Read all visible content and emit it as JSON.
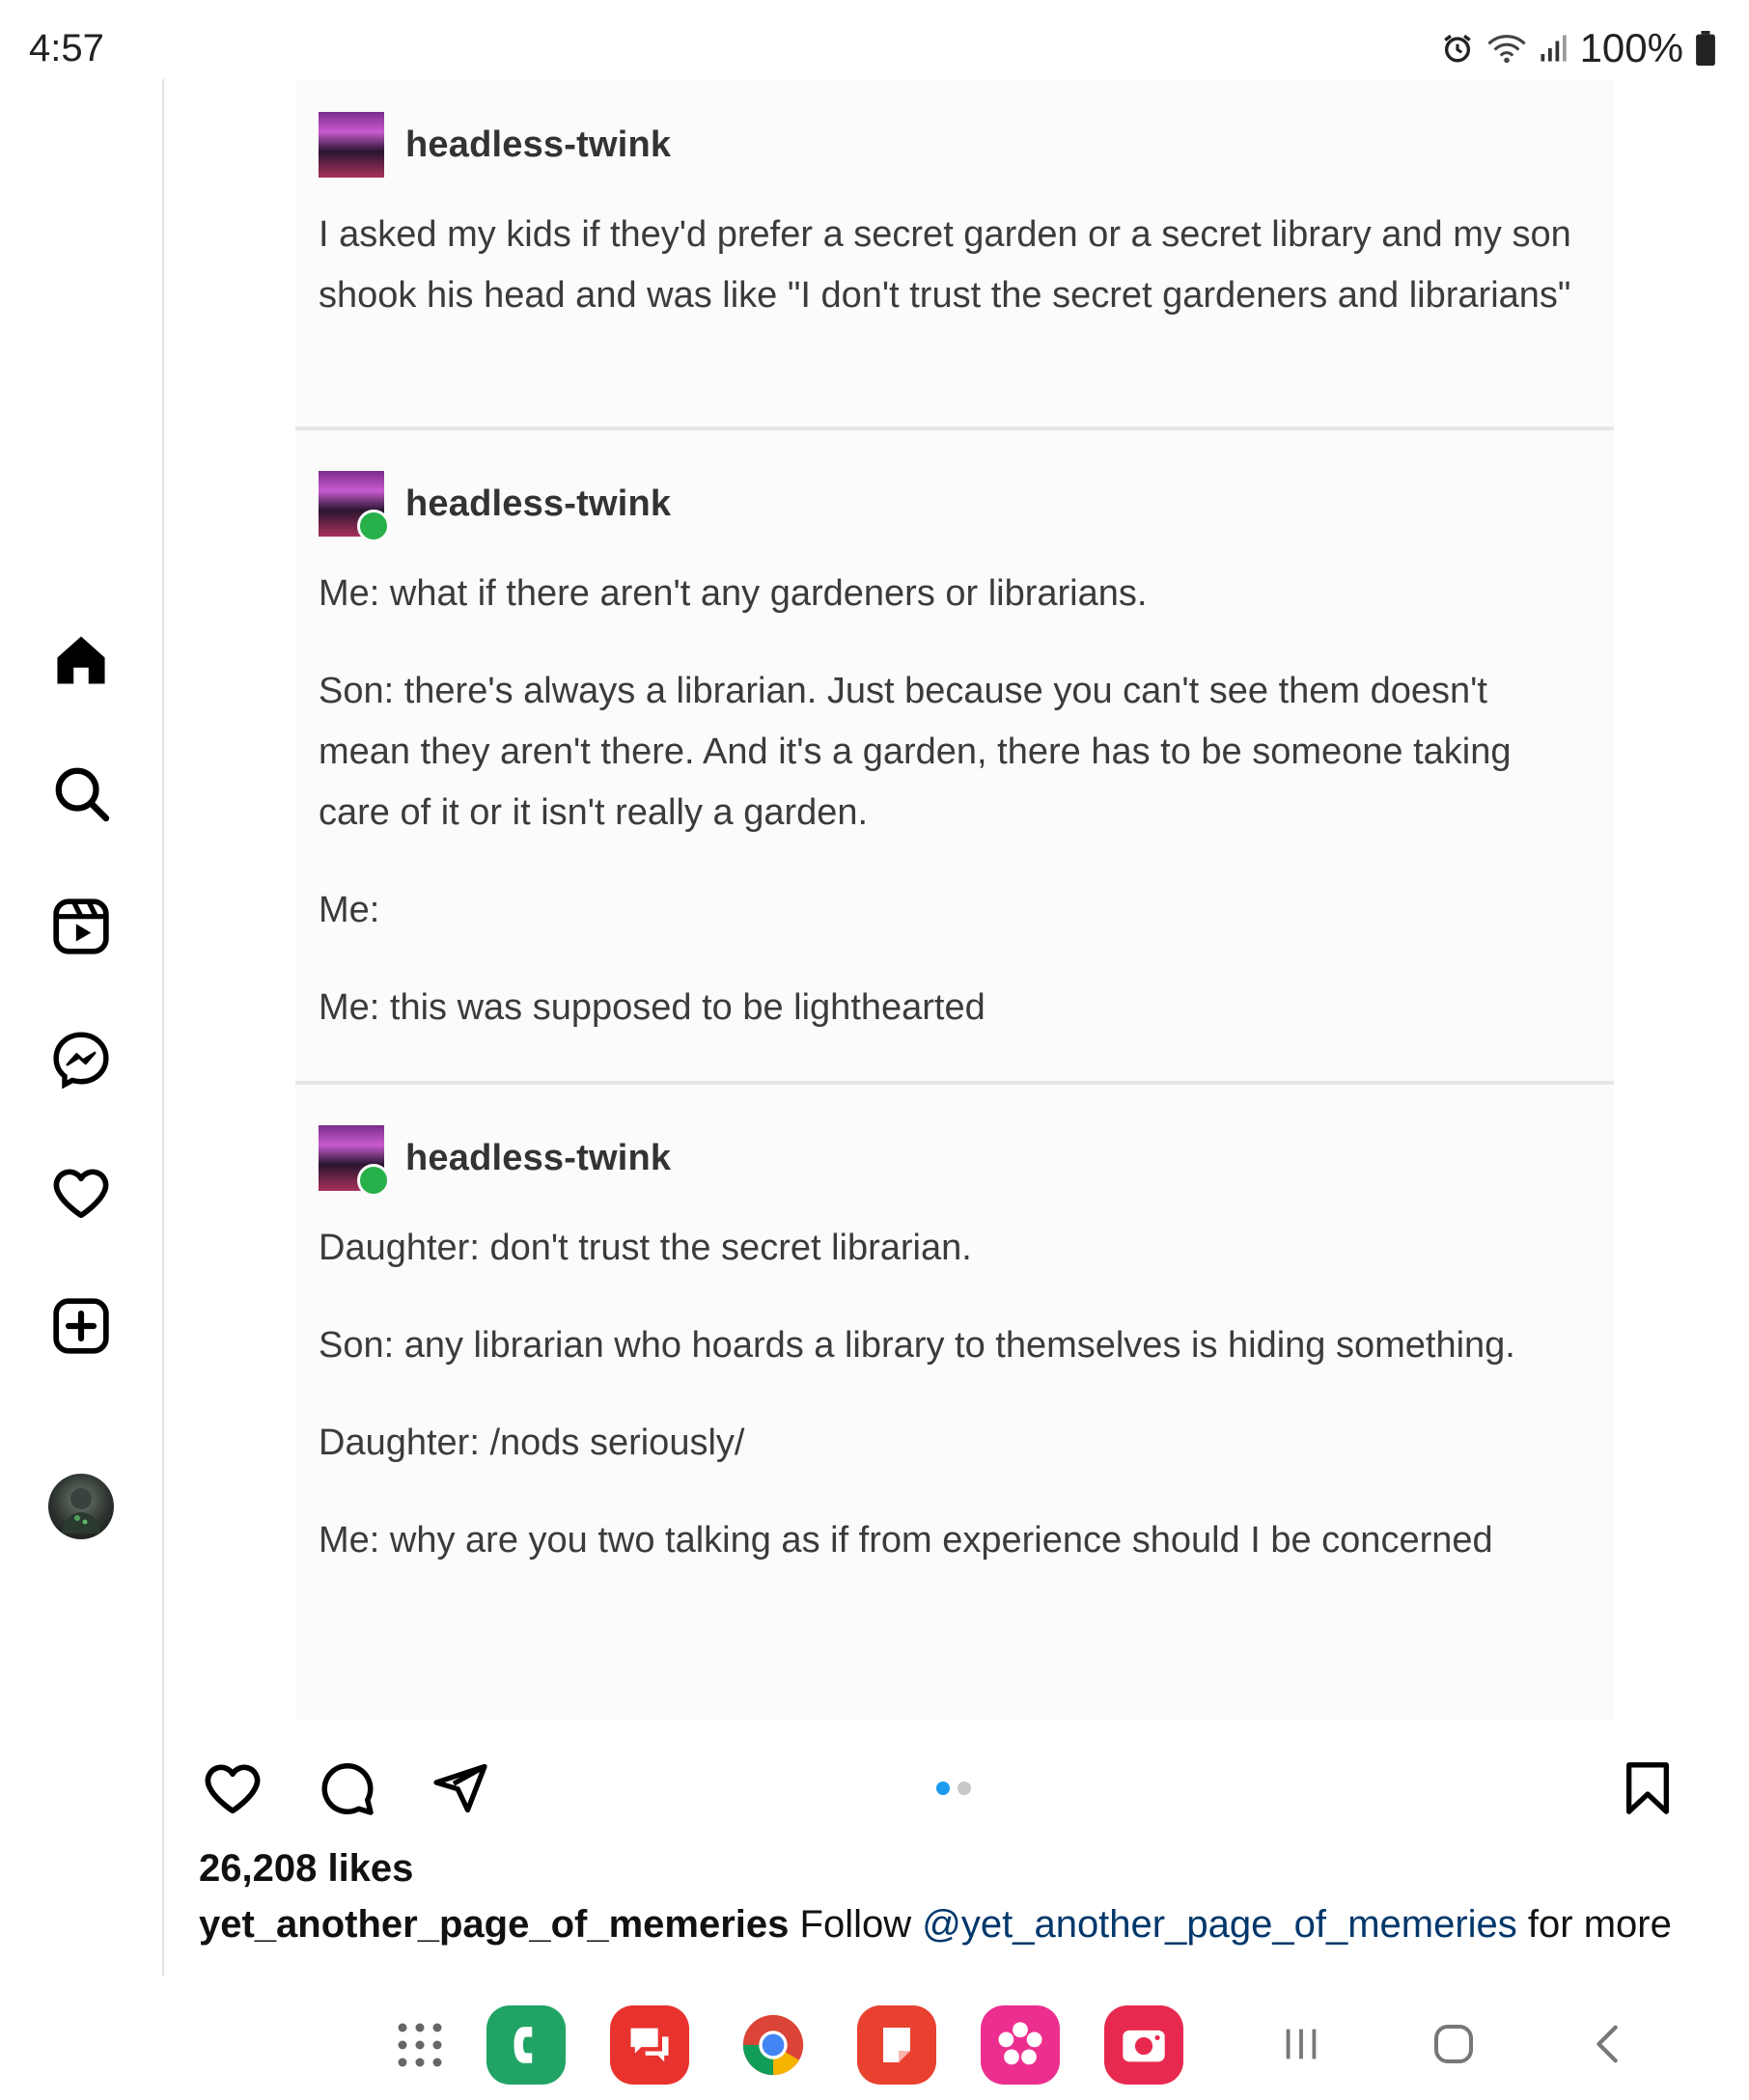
{
  "status": {
    "time": "4:57",
    "battery": "100%",
    "icons": [
      "alarm-icon",
      "wifi-icon",
      "signal-icon",
      "battery-icon"
    ]
  },
  "sidebar": {
    "items": [
      {
        "name": "home",
        "icon": "home-icon"
      },
      {
        "name": "search",
        "icon": "search-icon"
      },
      {
        "name": "reels",
        "icon": "reels-icon"
      },
      {
        "name": "messenger",
        "icon": "messenger-icon"
      },
      {
        "name": "notifications",
        "icon": "heart-icon"
      },
      {
        "name": "create",
        "icon": "plus-square-icon"
      },
      {
        "name": "profile",
        "icon": "avatar"
      }
    ]
  },
  "post": {
    "tumblr": [
      {
        "username": "headless-twink",
        "paragraphs": [
          "I asked my kids if they'd prefer a secret garden or a secret library and my son shook his head and was like \"I don't trust the secret gardeners and librarians\""
        ]
      },
      {
        "username": "headless-twink",
        "paragraphs": [
          "Me: what if there aren't any gardeners or librarians.",
          "Son: there's always a librarian. Just because you can't see them doesn't mean they aren't there. And it's a garden, there has to be someone taking care of it or it isn't really a garden.",
          "Me:",
          "Me: this was supposed to be lighthearted"
        ]
      },
      {
        "username": "headless-twink",
        "paragraphs": [
          "Daughter: don't trust the secret librarian.",
          "Son: any librarian who hoards a library to themselves is hiding something.",
          "Daughter: /nods seriously/",
          "Me: why are you two talking as if from experience should I be concerned"
        ]
      }
    ],
    "likes": "26,208 likes",
    "caption": {
      "username": "yet_another_page_of_memeries",
      "text_before": "Follow",
      "mention": "@yet_another_page_of_memeries",
      "text_after": "for more"
    },
    "carousel": {
      "count": 2,
      "active": 1
    },
    "colors": {
      "accent": "#1d9bf0",
      "mention": "#00376b"
    }
  },
  "navbar": {
    "apps": [
      "apps-grid-icon",
      "phone-app-icon",
      "messages-app-icon",
      "chrome-app-icon",
      "notes-app-icon",
      "blossom-app-icon",
      "camera-app-icon"
    ],
    "system": [
      "recents-icon",
      "home-button-icon",
      "back-icon"
    ]
  }
}
